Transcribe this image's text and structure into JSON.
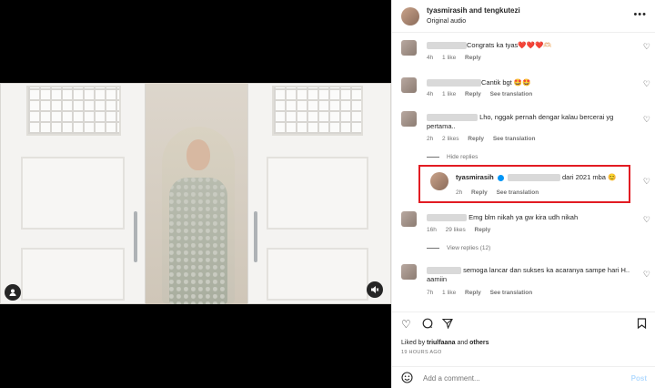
{
  "header": {
    "username": "tyasmirasih and tengkutezi",
    "audio": "Original audio"
  },
  "comments": [
    {
      "text": "Congrats ka tyas❤️❤️❤️🫶🏻",
      "time": "4h",
      "likes": "1 like",
      "reply": "Reply",
      "see_translation": ""
    },
    {
      "text": "Cantik bgt 🤩🤩",
      "time": "4h",
      "likes": "1 like",
      "reply": "Reply",
      "see_translation": "See translation"
    },
    {
      "text": "Lho, nggak pernah dengar kalau bercerai yg pertama..",
      "time": "2h",
      "likes": "2 likes",
      "reply": "Reply",
      "see_translation": "See translation"
    },
    {
      "text": "Emg blm nikah ya gw kira udh nikah",
      "time": "16h",
      "likes": "29 likes",
      "reply": "Reply",
      "see_translation": ""
    },
    {
      "text": "semoga lancar dan sukses ka acaranya sampe hari H.. aamiin",
      "time": "7h",
      "likes": "1 like",
      "reply": "Reply",
      "see_translation": "See translation"
    }
  ],
  "hide_replies": "Hide replies",
  "reply_highlight": {
    "username": "tyasmirasih",
    "text": "dari 2021 mba 😊",
    "time": "2h",
    "reply": "Reply",
    "see_translation": "See translation"
  },
  "view_replies": "View replies (12)",
  "liked_by": {
    "prefix": "Liked by ",
    "user": "triulfaana",
    "and": " and ",
    "others": "others"
  },
  "time_ago": "19 HOURS AGO",
  "add_comment": {
    "placeholder": "Add a comment...",
    "post": "Post"
  },
  "icons": [
    "heart-icon",
    "comment-icon",
    "share-icon",
    "bookmark-icon",
    "emoji-icon",
    "more-icon",
    "user-icon",
    "mute-icon"
  ],
  "colors": {
    "highlight": "#e21c23",
    "muted": "#737373",
    "post": "#b3dbff",
    "verified": "#0095f6"
  }
}
